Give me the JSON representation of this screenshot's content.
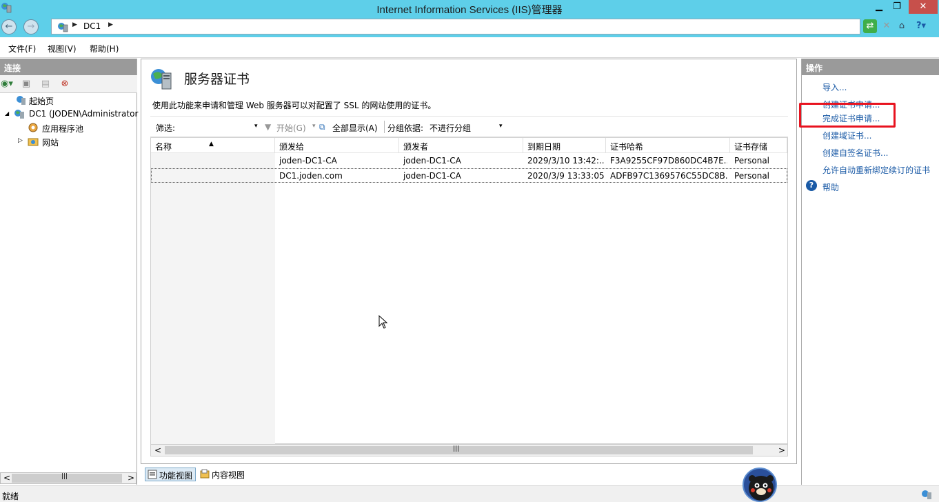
{
  "window": {
    "title": "Internet Information Services (IIS)管理器",
    "min": "▁",
    "max": "❐",
    "close": "✕"
  },
  "address": {
    "crumb": "DC1",
    "sep1": "▶",
    "sep2": "▶"
  },
  "menu": {
    "file": "文件(F)",
    "view": "视图(V)",
    "help": "帮助(H)"
  },
  "connections": {
    "header": "连接",
    "tree": [
      {
        "label": "起始页"
      },
      {
        "label": "DC1 (JODEN\\Administrator"
      },
      {
        "label": "应用程序池"
      },
      {
        "label": "网站"
      }
    ],
    "expand": "◢",
    "collapse": "▷",
    "scroll_left": "<",
    "scroll_thumb": "|||",
    "scroll_right": ">"
  },
  "main": {
    "title": "服务器证书",
    "description": "使用此功能来申请和管理 Web 服务器可以对配置了 SSL 的网站使用的证书。",
    "filter_label": "筛选:",
    "start_label": "开始(G)",
    "show_all_label": "全部显示(A)",
    "group_label": "分组依据:",
    "group_value": "不进行分组",
    "sort_indicator": "▲",
    "dd_arrow": "▾",
    "columns": [
      "名称",
      "颁发给",
      "颁发者",
      "到期日期",
      "证书哈希",
      "证书存储"
    ],
    "rows": [
      {
        "name": "",
        "issued_to": "joden-DC1-CA",
        "issuer": "joden-DC1-CA",
        "expires": "2029/3/10 13:42:...",
        "hash": "F3A9255CF97D860DC4B7E...",
        "store": "Personal"
      },
      {
        "name": "",
        "issued_to": "DC1.joden.com",
        "issuer": "joden-DC1-CA",
        "expires": "2020/3/9 13:33:05",
        "hash": "ADFB97C1369576C55DC8B...",
        "store": "Personal"
      }
    ],
    "scroll_left": "<",
    "scroll_thumb": "|||",
    "scroll_right": ">"
  },
  "tabs": {
    "features": "功能视图",
    "content": "内容视图"
  },
  "actions": {
    "header": "操作",
    "items": [
      "导入...",
      "创建证书申请...",
      "完成证书申请...",
      "创建域证书...",
      "创建自签名证书...",
      "允许自动重新绑定续订的证书",
      "帮助"
    ]
  },
  "status": {
    "text": "就绪"
  },
  "colors": {
    "titlebar": "#5ecfe9",
    "link": "#1a5aa6",
    "highlight": "#e8131f"
  }
}
